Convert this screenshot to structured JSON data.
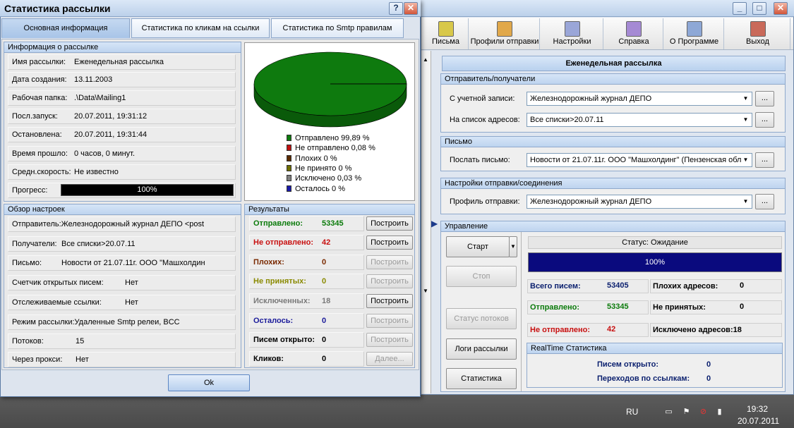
{
  "stats_window": {
    "title": "Статистика рассылки",
    "help_btn": "?",
    "close_btn": "✕",
    "tabs": [
      "Основная информация",
      "Статистика по кликам на ссылки",
      "Статистика по Smtp правилам"
    ],
    "info_group": {
      "title": "Информация о рассылке",
      "rows": [
        {
          "label": "Имя рассылки:",
          "value": "Еженедельная рассылка"
        },
        {
          "label": "Дата создания:",
          "value": "13.11.2003"
        },
        {
          "label": "Рабочая папка:",
          "value": ".\\Data\\Mailing1"
        },
        {
          "label": "Посл.запуск:",
          "value": "20.07.2011, 19:31:12"
        },
        {
          "label": "Остановлена:",
          "value": "20.07.2011, 19:31:44"
        },
        {
          "label": "Время прошло:",
          "value": "0 часов, 0 минут."
        },
        {
          "label": "Средн.скорость:",
          "value": "Не известно"
        }
      ],
      "progress_label": "Прогресс:",
      "progress_text": "100%",
      "progress_value": 1.0
    },
    "pie": {
      "legend": [
        {
          "text": "Отправлено 99,89 %",
          "color": "#0e7a0e"
        },
        {
          "text": "Не отправлено 0,08 %",
          "color": "#c01010"
        },
        {
          "text": "Плохих 0 %",
          "color": "#5a2a00"
        },
        {
          "text": "Не принято 0 %",
          "color": "#6e6e00"
        },
        {
          "text": "Исключено 0,03 %",
          "color": "#808080"
        },
        {
          "text": "Осталось 0 %",
          "color": "#1a1aa8"
        }
      ],
      "values": [
        99.89,
        0.08,
        0,
        0,
        0.03,
        0
      ]
    },
    "overview_group": {
      "title": "Обзор настроек",
      "rows": [
        {
          "label": "Отправитель:",
          "value": "Железнодорожный журнал ДЕПО <post"
        },
        {
          "label": "Получатели:",
          "value": "Все списки>20.07.11"
        },
        {
          "label": "Письмо:",
          "value": "Новости от 21.07.11г. ООО \"Машхолдин"
        },
        {
          "label": "Счетчик открытых писем:",
          "value": "Нет"
        },
        {
          "label": "Отслеживаемые ссылки:",
          "value": "Нет"
        },
        {
          "label": "Режим рассылки:",
          "value": "Удаленные Smtp релеи, BCC"
        },
        {
          "label": "Потоков:",
          "value": "15"
        },
        {
          "label": "Через прокси:",
          "value": "Нет"
        }
      ]
    },
    "results_group": {
      "title": "Результаты",
      "rows": [
        {
          "label": "Отправлено:",
          "value": "53345",
          "color": "#0a7a0a",
          "btn": "Построить",
          "enabled": true
        },
        {
          "label": "Не отправлено:",
          "value": "42",
          "color": "#c81010",
          "btn": "Построить",
          "enabled": true
        },
        {
          "label": "Плохих:",
          "value": "0",
          "color": "#7a2a00",
          "btn": "Построить",
          "enabled": false
        },
        {
          "label": "Не принятых:",
          "value": "0",
          "color": "#8a8a00",
          "btn": "Построить",
          "enabled": false
        },
        {
          "label": "Исключенных:",
          "value": "18",
          "color": "#7a7a7a",
          "btn": "Построить",
          "enabled": true
        },
        {
          "label": "Осталось:",
          "value": "0",
          "color": "#1a1a9a",
          "btn": "Построить",
          "enabled": false
        },
        {
          "label": "Писем открыто:",
          "value": "0",
          "color": "#000000",
          "btn": "Построить",
          "enabled": false
        },
        {
          "label": "Кликов:",
          "value": "0",
          "color": "#000000",
          "btn": "Далее...",
          "enabled": false
        }
      ]
    },
    "ok_btn": "Ok"
  },
  "main_window": {
    "toolbar": [
      {
        "label": "Письма",
        "icon": "letters-icon"
      },
      {
        "label": "Профили отправки",
        "icon": "profiles-icon"
      },
      {
        "label": "Настройки",
        "icon": "settings-icon"
      },
      {
        "label": "Справка",
        "icon": "help-icon"
      },
      {
        "label": "О Программе",
        "icon": "about-icon"
      },
      {
        "label": "Выход",
        "icon": "exit-icon"
      }
    ],
    "mailing_title": "Еженедельная рассылка",
    "sender_group": {
      "title": "Отправитель/получатели",
      "account_label": "С учетной записи:",
      "account_value": "Железнодорожный журнал ДЕПО",
      "list_label": "На список адресов:",
      "list_value": "Все списки>20.07.11"
    },
    "letter_group": {
      "title": "Письмо",
      "send_label": "Послать письмо:",
      "send_value": "Новости от 21.07.11г. ООО \"Машхолдинг\" (Пензенская обл"
    },
    "conn_group": {
      "title": "Настройки отправки/соединения",
      "profile_label": "Профиль отправки:",
      "profile_value": "Железнодорожный журнал ДЕПО"
    },
    "browse_btn": "...",
    "control_group": {
      "title": "Управление",
      "start": "Старт",
      "stop": "Стоп",
      "threads": "Статус потоков",
      "logs": "Логи рассылки",
      "stats": "Статистика",
      "status": "Статус: Ожидание",
      "progress": "100%",
      "progress_value": 1.0,
      "total_label": "Всего писем:",
      "total_value": "53405",
      "bad_label": "Плохих адресов:",
      "bad_value": "0",
      "sent_label": "Отправлено:",
      "sent_value": "53345",
      "rejected_label": "Не принятых:",
      "rejected_value": "0",
      "notsent_label": "Не отправлено:",
      "notsent_value": "42",
      "excluded_label": "Исключено адресов:",
      "excluded_value": "18",
      "rt_title": "RealTime Статистика",
      "opened_label": "Писем открыто:",
      "opened_value": "0",
      "clicks_label": "Переходов по ссылкам:",
      "clicks_value": "0"
    }
  },
  "taskbar": {
    "lang": "RU",
    "time": "19:32",
    "date": "20.07.2011"
  }
}
